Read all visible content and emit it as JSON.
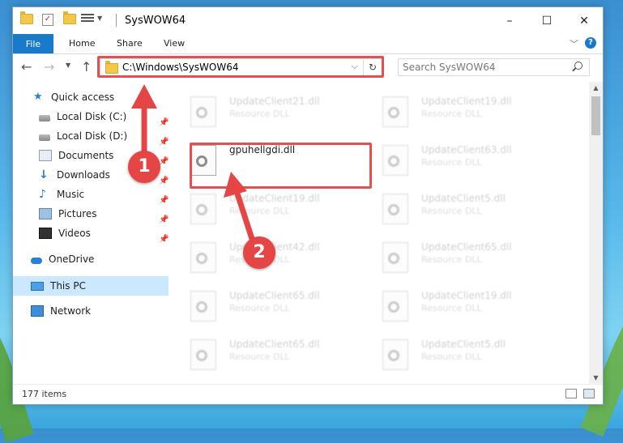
{
  "window": {
    "title": "SysWOW64",
    "controls": {
      "minimize": "–",
      "maximize": "☐",
      "close": "✕"
    }
  },
  "ribbon": {
    "tabs": [
      "File",
      "Home",
      "Share",
      "View"
    ],
    "help": "?"
  },
  "address": {
    "path": "C:\\Windows\\SysWOW64",
    "search_placeholder": "Search SysWOW64"
  },
  "sidebar": {
    "items": [
      {
        "label": "Quick access",
        "icon": "star-icon",
        "pinned": false
      },
      {
        "label": "Local Disk (C:)",
        "icon": "drive-icon",
        "pinned": true
      },
      {
        "label": "Local Disk (D:)",
        "icon": "drive-icon",
        "pinned": true
      },
      {
        "label": "Documents",
        "icon": "documents-icon",
        "pinned": true
      },
      {
        "label": "Downloads",
        "icon": "downloads-icon",
        "pinned": true
      },
      {
        "label": "Music",
        "icon": "music-icon",
        "pinned": true
      },
      {
        "label": "Pictures",
        "icon": "pictures-icon",
        "pinned": true
      },
      {
        "label": "Videos",
        "icon": "videos-icon",
        "pinned": true
      },
      {
        "label": "OneDrive",
        "icon": "onedrive-icon",
        "pinned": false
      },
      {
        "label": "This PC",
        "icon": "pc-icon",
        "pinned": false,
        "selected": true
      },
      {
        "label": "Network",
        "icon": "network-icon",
        "pinned": false
      }
    ]
  },
  "files": [
    {
      "name": "UpdateClient21.dll",
      "type": "Resource DLL"
    },
    {
      "name": "UpdateClient19.dll",
      "type": "Resource DLL"
    },
    {
      "name": "gpuhellgdi.dll",
      "type": ""
    },
    {
      "name": "UpdateClient63.dll",
      "type": "Resource DLL"
    },
    {
      "name": "UpdateClient19.dll",
      "type": "Resource DLL"
    },
    {
      "name": "UpdateClient5.dll",
      "type": "Resource DLL"
    },
    {
      "name": "UpdateClient42.dll",
      "type": "Resource DLL"
    },
    {
      "name": "UpdateClient65.dll",
      "type": "Resource DLL"
    },
    {
      "name": "UpdateClient65.dll",
      "type": "Resource DLL"
    },
    {
      "name": "UpdateClient19.dll",
      "type": "Resource DLL"
    },
    {
      "name": "UpdateClient65.dll",
      "type": "Resource DLL"
    },
    {
      "name": "UpdateClient5.dll",
      "type": "Resource DLL"
    }
  ],
  "status": {
    "item_count": "177 items"
  },
  "annotations": {
    "step1": "1",
    "step2": "2",
    "highlight_color": "#e45050"
  }
}
